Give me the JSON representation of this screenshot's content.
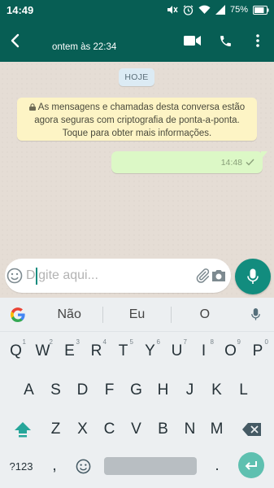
{
  "status_bar": {
    "time": "14:49",
    "battery_percent": "75%"
  },
  "header": {
    "last_seen": "ontem às 22:34"
  },
  "chat": {
    "date_label": "HOJE",
    "encryption_notice": "As mensagens e chamadas desta conversa estão agora seguras com criptografia de ponta-a-ponta. Toque para obter mais informações.",
    "message": {
      "time": "14:48",
      "status": "sent"
    }
  },
  "composer": {
    "placeholder": "Digite aqui..."
  },
  "keyboard": {
    "suggestions": [
      "Não",
      "Eu",
      "O"
    ],
    "row1": [
      {
        "key": "Q",
        "hint": "1"
      },
      {
        "key": "W",
        "hint": "2"
      },
      {
        "key": "E",
        "hint": "3"
      },
      {
        "key": "R",
        "hint": "4"
      },
      {
        "key": "T",
        "hint": "5"
      },
      {
        "key": "Y",
        "hint": "6"
      },
      {
        "key": "U",
        "hint": "7"
      },
      {
        "key": "I",
        "hint": "8"
      },
      {
        "key": "O",
        "hint": "9"
      },
      {
        "key": "P",
        "hint": "0"
      }
    ],
    "row2": [
      "A",
      "S",
      "D",
      "F",
      "G",
      "H",
      "J",
      "K",
      "L"
    ],
    "row3": [
      "Z",
      "X",
      "C",
      "V",
      "B",
      "N",
      "M"
    ],
    "symbols_key": "?123",
    "comma_key": ",",
    "period_key": "."
  },
  "colors": {
    "header_green": "#075e54",
    "accent_teal": "#128c7e",
    "outgoing_bubble": "#dcf8c6",
    "notice_yellow": "#fdf4c5"
  }
}
